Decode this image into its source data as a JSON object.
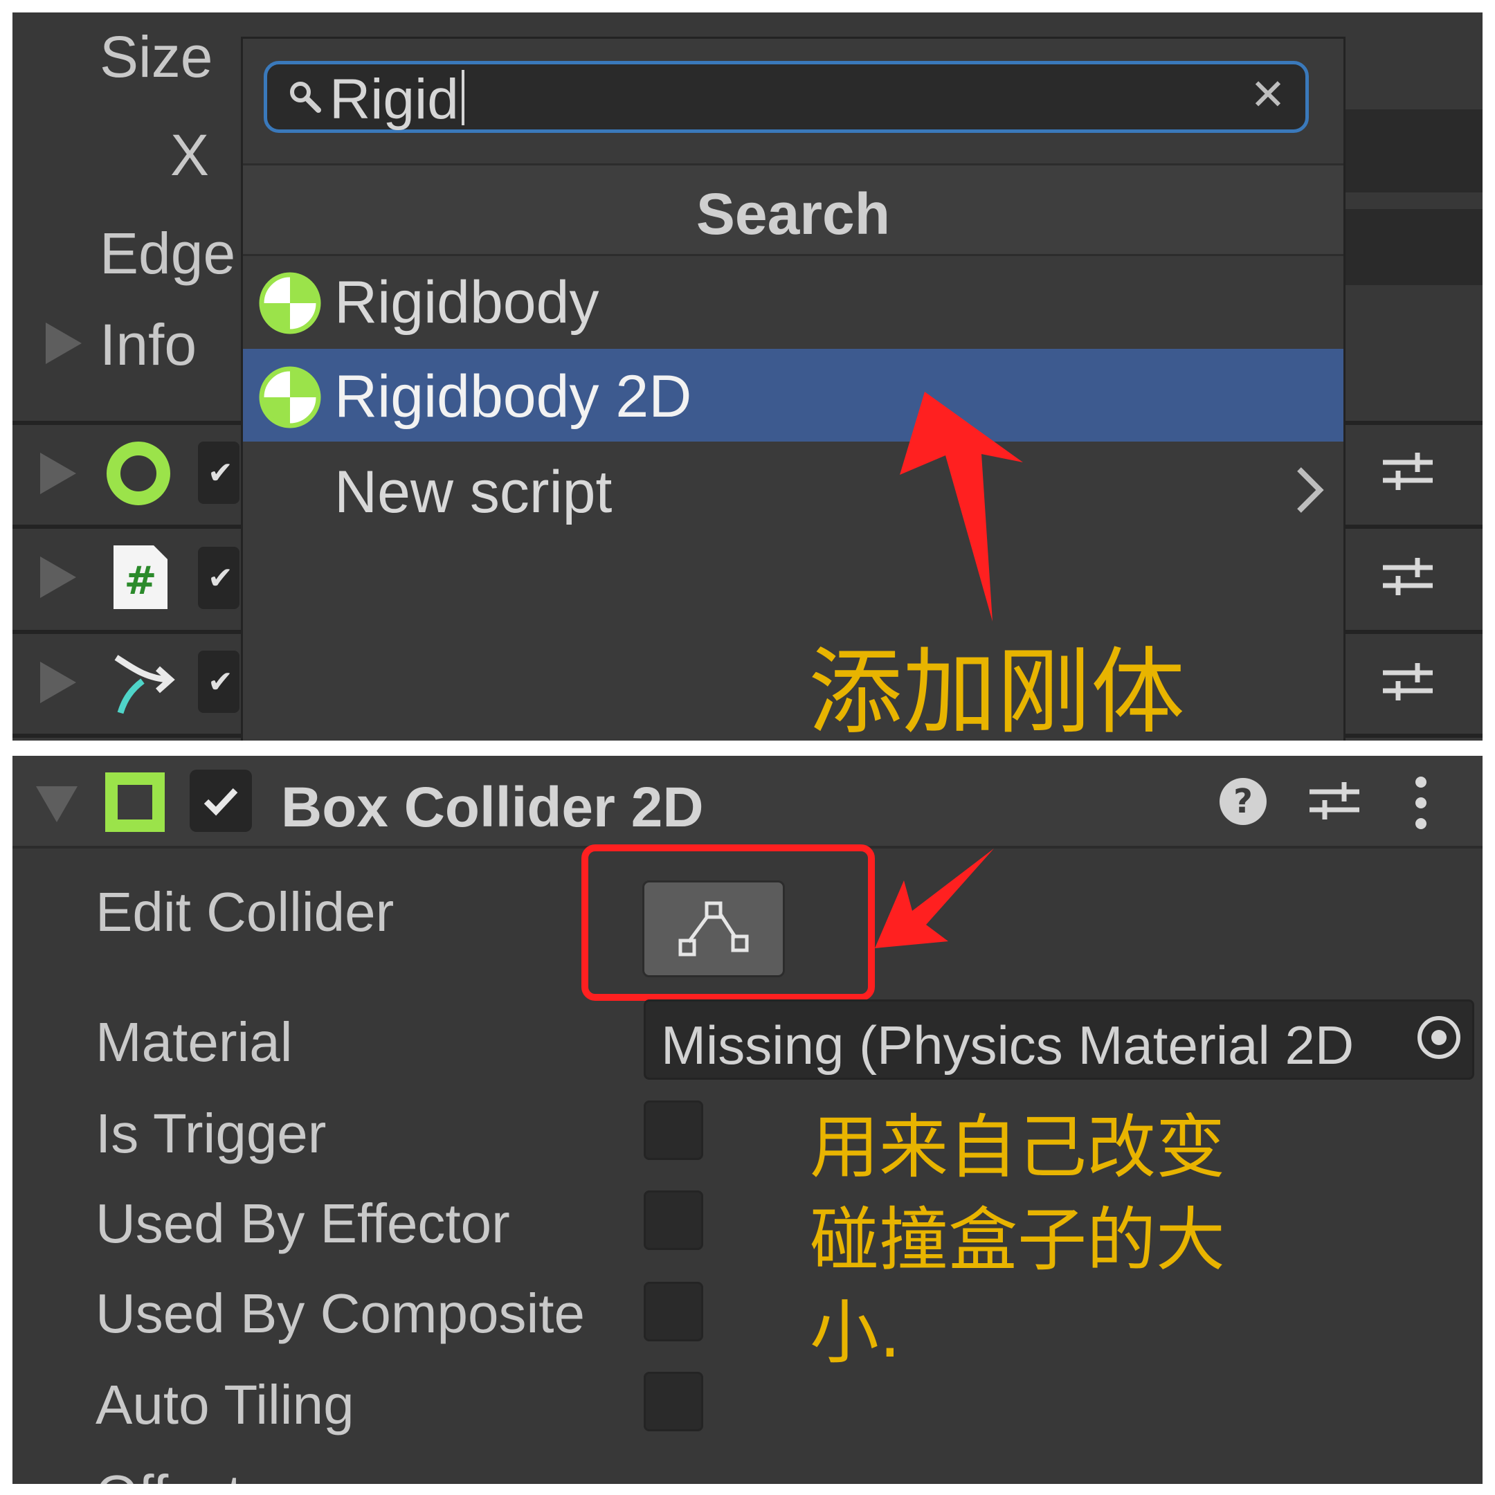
{
  "top_panel": {
    "bg_labels": {
      "size": "Size",
      "x": "X",
      "edge": "Edge",
      "info": "Info"
    },
    "dropdown": {
      "search": {
        "value": "Rigid",
        "icon": "search-icon",
        "clear_icon": "close-icon"
      },
      "header": "Search",
      "items": [
        {
          "label": "Rigidbody",
          "icon": "rigidbody-icon",
          "selected": false
        },
        {
          "label": "Rigidbody 2D",
          "icon": "rigidbody-2d-icon",
          "selected": true
        },
        {
          "label": "New script",
          "icon": "chevron-right-icon",
          "selected": false
        }
      ]
    },
    "annotation": "添加刚体"
  },
  "bottom_panel": {
    "component": {
      "title": "Box Collider 2D",
      "enabled": true,
      "icons": [
        "box-collider-icon",
        "help-icon",
        "preset-sliders-icon",
        "kebab-menu-icon"
      ]
    },
    "properties": {
      "edit_collider": "Edit Collider",
      "material": "Material",
      "material_value": "Missing (Physics Material 2D",
      "is_trigger": "Is Trigger",
      "used_by_effector": "Used By Effector",
      "used_by_composite": "Used By Composite",
      "auto_tiling": "Auto Tiling",
      "offset": "Offset"
    },
    "annotation": {
      "line1": "用来自己改变",
      "line2": "碰撞盒子的大",
      "line3": "小."
    }
  },
  "colors": {
    "panel_bg": "#383838",
    "selection": "#3d5a8f",
    "search_border": "#3a79bb",
    "annotation_text": "#e8b400",
    "annotation_red": "#ff2020",
    "component_green": "#9be34a"
  }
}
